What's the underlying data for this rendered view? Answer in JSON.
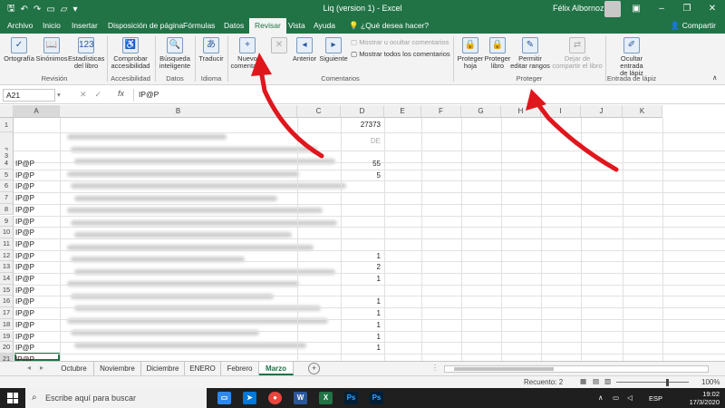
{
  "window": {
    "title": "Liq (version 1)  -  Excel",
    "user": "Félix Albornoz"
  },
  "tabs": [
    "Archivo",
    "Inicio",
    "Insertar",
    "Disposición de página",
    "Fórmulas",
    "Datos",
    "Revisar",
    "Vista",
    "Ayuda"
  ],
  "active_tab": "Revisar",
  "tell_me": "¿Qué desea hacer?",
  "share": "Compartir",
  "ribbon": {
    "revision": {
      "label": "Revisión",
      "ortografia": "Ortografía",
      "sinonimos": "Sinónimos",
      "estadisticas_1": "Estadísticas",
      "estadisticas_2": "del libro"
    },
    "accesibilidad": {
      "label": "Accesibilidad",
      "comprobar_1": "Comprobar",
      "comprobar_2": "accesibilidad"
    },
    "datos": {
      "label": "Datos",
      "busqueda_1": "Búsqueda",
      "busqueda_2": "inteligente"
    },
    "idioma": {
      "label": "Idioma",
      "traducir": "Traducir"
    },
    "comentarios": {
      "label": "Comentarios",
      "nuevo_1": "Nuevo",
      "nuevo_2": "comentario",
      "anterior": "Anterior",
      "siguiente": "Siguiente",
      "mostrar_ocultar": "Mostrar u ocultar comentarios",
      "mostrar_todos": "Mostrar todos los comentarios"
    },
    "proteger": {
      "label": "Proteger",
      "hoja_1": "Proteger",
      "hoja_2": "hoja",
      "libro_1": "Proteger",
      "libro_2": "libro",
      "rangos_1": "Permitir",
      "rangos_2": "editar rangos",
      "dejar_1": "Dejar de",
      "dejar_2": "compartir el libro"
    },
    "lapiz": {
      "label": "Entrada de lápiz",
      "ocultar_1": "Ocultar entrada",
      "ocultar_2": "de lápiz"
    }
  },
  "formula_bar": {
    "name_box": "A21",
    "fx": "fx",
    "value": "IP@P"
  },
  "grid": {
    "columns": [
      "A",
      "B",
      "C",
      "D",
      "E",
      "F",
      "G",
      "H",
      "I",
      "J",
      "K"
    ],
    "rows": [
      "1",
      "2",
      "3",
      "4",
      "5",
      "6",
      "7",
      "8",
      "9",
      "10",
      "11",
      "12",
      "13",
      "14",
      "15",
      "16",
      "17",
      "18",
      "19",
      "20",
      "21"
    ],
    "col_a_values": [
      "IP@P",
      "IP@P",
      "IP@P",
      "IP@P",
      "IP@P",
      "IP@P",
      "IP@P",
      "IP@P",
      "IP@P",
      "IP@P",
      "IP@P",
      "IP@P",
      "IP@P",
      "IP@P",
      "IP@P",
      "IP@P",
      "IP@P",
      "IP@P",
      "IP@P"
    ],
    "d1": "27373",
    "d2": "DE",
    "d_values": [
      "55",
      "5",
      "",
      "",
      "",
      "",
      "",
      "",
      "1",
      "2",
      "1",
      "",
      "1",
      "1",
      "1",
      "1",
      "1",
      "",
      ""
    ]
  },
  "sheets": [
    "Octubre",
    "Noviembre",
    "Diciembre",
    "ENERO",
    "Febrero",
    "Marzo"
  ],
  "active_sheet": "Marzo",
  "status": {
    "count": "Recuento: 2",
    "zoom": "100%"
  },
  "taskbar": {
    "search_placeholder": "Escribe aquí para buscar",
    "lang": "ESP",
    "time": "19:02",
    "date": "17/3/2020"
  },
  "colors": {
    "excel_green": "#217346",
    "arrow_red": "#e0161d"
  }
}
